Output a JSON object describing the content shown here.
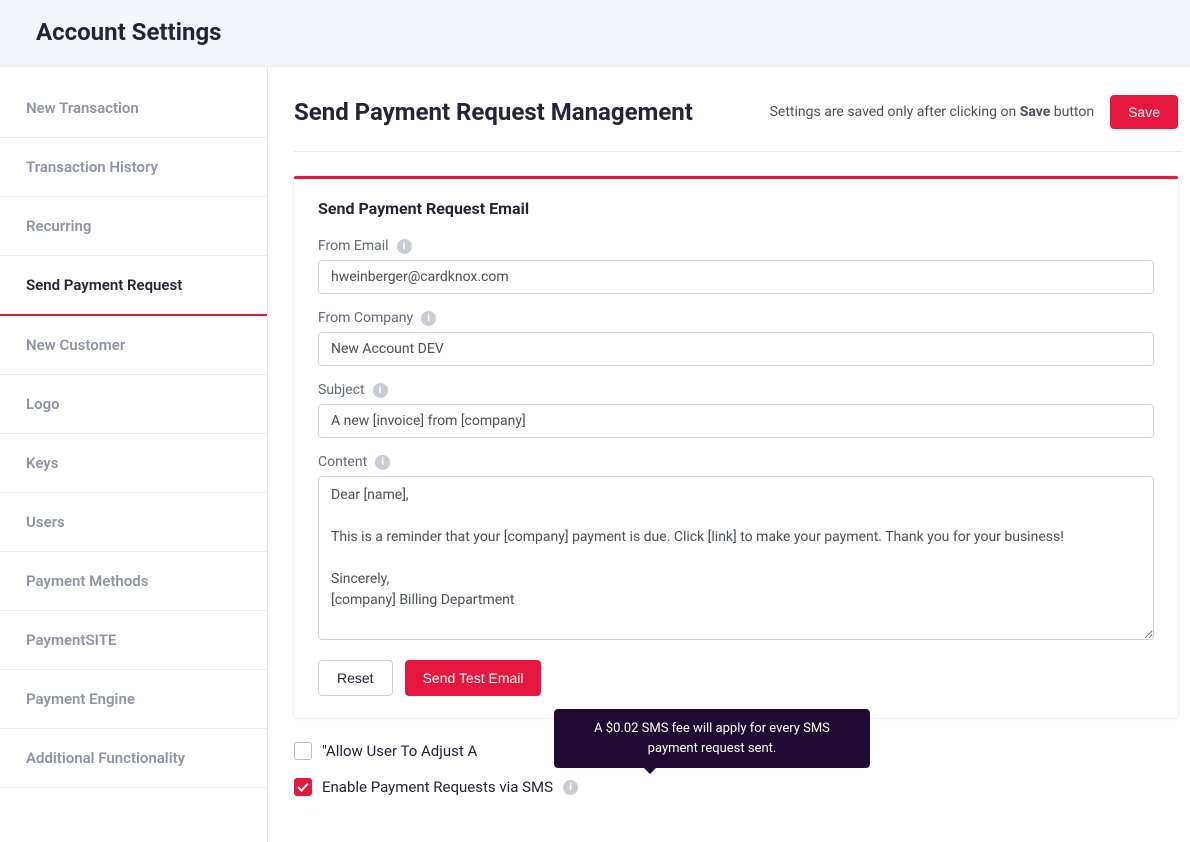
{
  "header": {
    "title": "Account Settings"
  },
  "sidebar": {
    "items": [
      {
        "label": "New Transaction"
      },
      {
        "label": "Transaction History"
      },
      {
        "label": "Recurring"
      },
      {
        "label": "Send Payment Request"
      },
      {
        "label": "New Customer"
      },
      {
        "label": "Logo"
      },
      {
        "label": "Keys"
      },
      {
        "label": "Users"
      },
      {
        "label": "Payment Methods"
      },
      {
        "label": "PaymentSITE"
      },
      {
        "label": "Payment Engine"
      },
      {
        "label": "Additional Functionality"
      }
    ],
    "active_index": 3
  },
  "main": {
    "title": "Send Payment Request Management",
    "save_hint_prefix": "Settings are saved only after clicking on ",
    "save_hint_bold": "Save",
    "save_hint_suffix": " button",
    "save_button": "Save"
  },
  "card": {
    "title": "Send Payment Request Email",
    "from_email_label": "From Email",
    "from_email_value": "hweinberger@cardknox.com",
    "from_company_label": "From Company",
    "from_company_value": "New Account DEV",
    "subject_label": "Subject",
    "subject_value": "A new [invoice] from [company]",
    "content_label": "Content",
    "content_value": "Dear [name],\n\nThis is a reminder that your [company] payment is due. Click [link] to make your payment. Thank you for your business!\n\nSincerely,\n[company] Billing Department",
    "reset_button": "Reset",
    "send_test_button": "Send Test Email"
  },
  "options": {
    "allow_adjust_label": "\"Allow User To Adjust A",
    "allow_adjust_checked": false,
    "enable_sms_label": "Enable Payment Requests via SMS",
    "enable_sms_checked": true,
    "sms_tooltip": "A $0.02 SMS fee will apply for every SMS payment request sent."
  },
  "info_glyph": "i"
}
